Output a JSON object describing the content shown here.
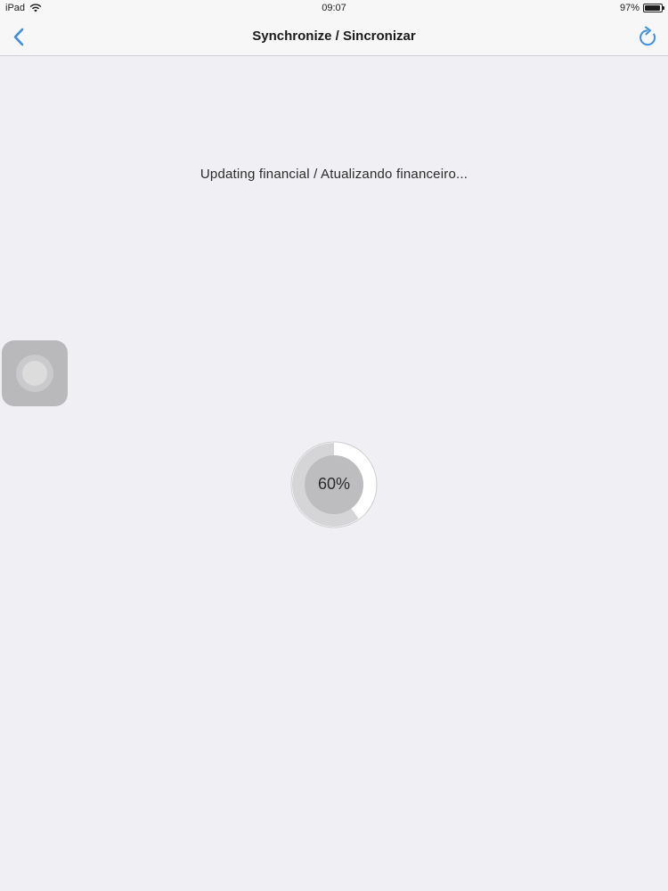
{
  "status_bar": {
    "carrier": "iPad",
    "time": "09:07",
    "battery_label": "97%",
    "battery_level": 0.97
  },
  "nav": {
    "title": "Synchronize / Sincronizar",
    "back_icon": "chevron-left-icon",
    "refresh_icon": "refresh-icon",
    "accent_color": "#3d8ee6"
  },
  "sync": {
    "message": "Updating financial / Atualizando financeiro...",
    "progress_label": "60%",
    "progress_fraction": 0.6
  },
  "colors": {
    "background": "#efeff4",
    "progress_track": "#ffffff",
    "progress_fill": "#d5d5d7",
    "progress_inner": "#bdbdbf"
  }
}
